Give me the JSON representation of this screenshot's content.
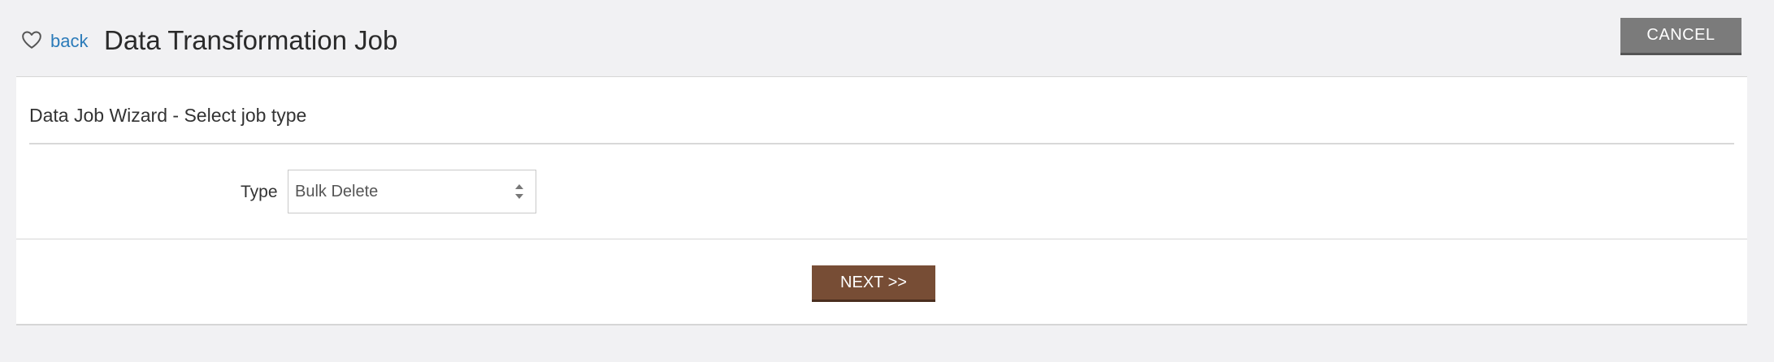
{
  "header": {
    "back_label": "back",
    "title": "Data Transformation Job",
    "cancel_label": "CANCEL"
  },
  "wizard": {
    "title": "Data Job Wizard - Select job type",
    "type_label": "Type",
    "type_value": "Bulk Delete",
    "next_label": "NEXT >>"
  },
  "colors": {
    "link": "#2b7bb9",
    "cancel_button": "#7b7b7b",
    "next_button": "#774d35"
  },
  "icons": {
    "back": "heart-outline-icon",
    "select": "up-down-arrows-icon"
  }
}
